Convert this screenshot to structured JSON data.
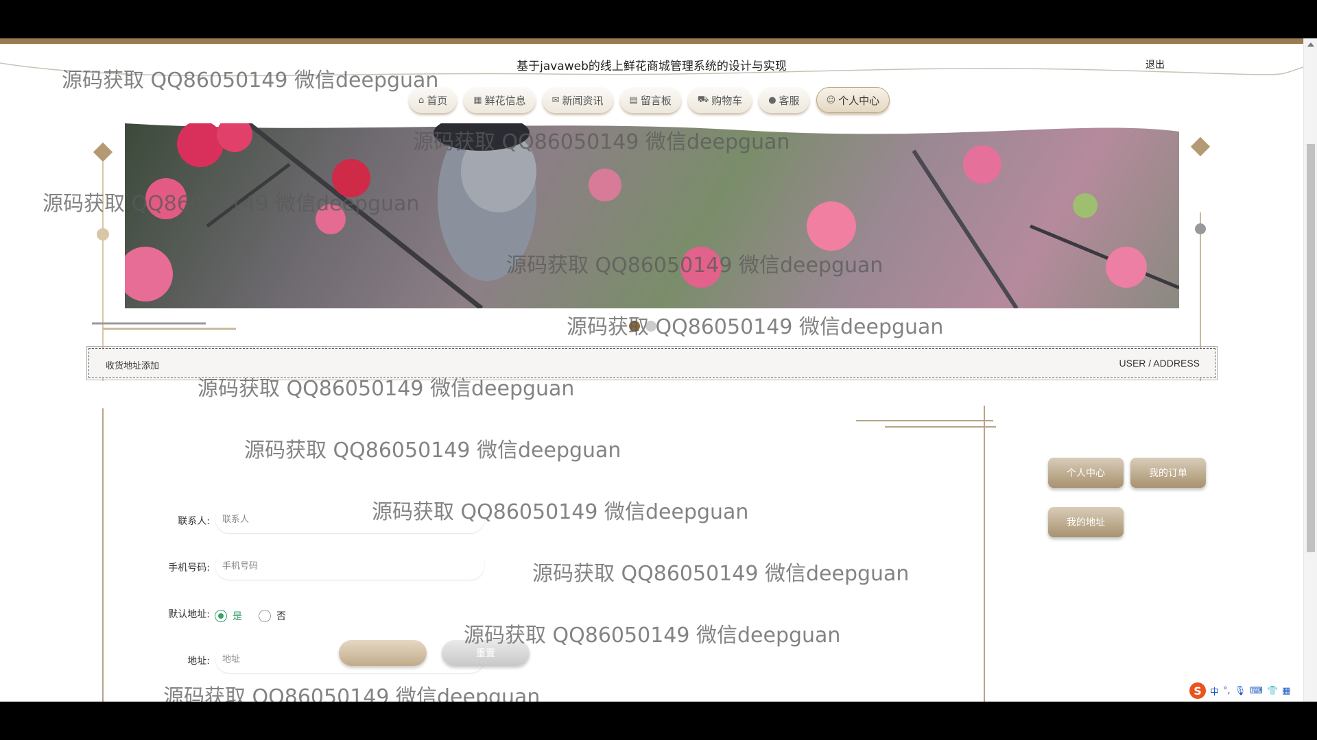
{
  "header": {
    "title": "基于javaweb的线上鲜花商城管理系统的设计与实现",
    "logout_label": "退出"
  },
  "nav": {
    "items": [
      {
        "label": "首页",
        "icon": "home-icon",
        "glyph": "⌂"
      },
      {
        "label": "鲜花信息",
        "icon": "gift-icon",
        "glyph": "▦"
      },
      {
        "label": "新闻资讯",
        "icon": "mail-icon",
        "glyph": "✉"
      },
      {
        "label": "留言板",
        "icon": "clipboard-icon",
        "glyph": "▤"
      },
      {
        "label": "购物车",
        "icon": "cart-icon",
        "glyph": "⛟"
      },
      {
        "label": "客服",
        "icon": "chat-icon",
        "glyph": "●"
      },
      {
        "label": "个人中心",
        "icon": "user-icon",
        "glyph": "☺"
      }
    ],
    "active_index": 6
  },
  "banner": {
    "carousel_slides": 2,
    "active_slide": 0
  },
  "section": {
    "title": "收货地址添加",
    "subtitle": "USER / ADDRESS"
  },
  "form": {
    "contact_label": "联系人:",
    "contact_placeholder": "联系人",
    "phone_label": "手机号码:",
    "phone_placeholder": "手机号码",
    "default_label": "默认地址:",
    "default_yes": "是",
    "default_no": "否",
    "default_value": "是",
    "address_label": "地址:",
    "address_placeholder": "地址",
    "reset_label": "重置"
  },
  "sidebar": {
    "personal_center": "个人中心",
    "my_orders": "我的订单",
    "my_address": "我的地址"
  },
  "watermark": {
    "text": "源码获取 QQ86050149 微信deepguan"
  },
  "tray": {
    "ime_label": "中"
  },
  "colors": {
    "accent": "#9b7b52",
    "button_gold": "#c2ab8b",
    "radio_checked": "#3aa06a"
  }
}
